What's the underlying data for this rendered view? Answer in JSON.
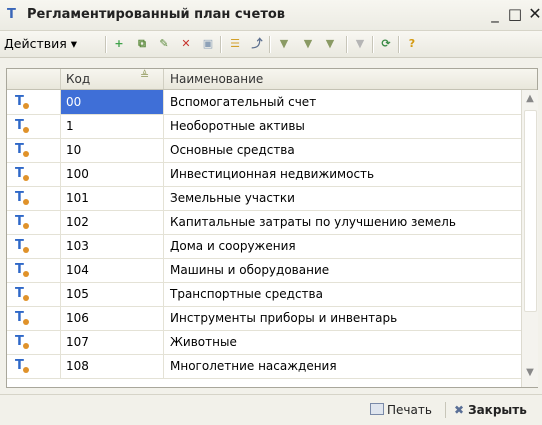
{
  "window": {
    "title": "Регламентированный план счетов",
    "app_icon": "Т",
    "minimize": "_",
    "maximize": "□",
    "close": "✕"
  },
  "toolbar": {
    "actions_label": "Действия",
    "actions_arrow": "▾",
    "icons": [
      {
        "name": "add-icon",
        "glyph": "+",
        "color": "#3fa24a"
      },
      {
        "name": "copy-icon",
        "glyph": "⧉",
        "color": "#5b8a3c"
      },
      {
        "name": "edit-icon",
        "glyph": "✎",
        "color": "#5b8a3c"
      },
      {
        "name": "delete-icon",
        "glyph": "✕",
        "color": "#c7332d"
      },
      {
        "name": "save-icon",
        "glyph": "▣",
        "color": "#8ea2b8"
      },
      {
        "name": "hierarchy-icon",
        "glyph": "☰",
        "color": "#d2a02a"
      },
      {
        "name": "move-icon",
        "glyph": "⤴",
        "color": "#5c6f8f"
      },
      {
        "name": "filter-icon",
        "glyph": "▼",
        "color": "#8a9a64"
      },
      {
        "name": "filter-list-icon",
        "glyph": "▼",
        "color": "#8a9a64"
      },
      {
        "name": "filter-dropdown-icon",
        "glyph": "▼",
        "color": "#8a9a64"
      },
      {
        "name": "clear-filter-icon",
        "glyph": "▼",
        "color": "#b5b5b5"
      },
      {
        "name": "refresh-icon",
        "glyph": "⟳",
        "color": "#3a8a45"
      },
      {
        "name": "help-icon",
        "glyph": "?",
        "color": "#d59a10"
      }
    ]
  },
  "table": {
    "columns": {
      "icon": "",
      "code": "Код",
      "name": "Наименование"
    },
    "sort_icon": "≜",
    "rows": [
      {
        "code": "00",
        "name": "Вспомогательный счет",
        "selected": true
      },
      {
        "code": "1",
        "name": "Необоротные активы"
      },
      {
        "code": "10",
        "name": "Основные средства"
      },
      {
        "code": "100",
        "name": "Инвестиционная недвижимость"
      },
      {
        "code": "101",
        "name": "Земельные участки"
      },
      {
        "code": "102",
        "name": "Капитальные затраты по улучшению земель"
      },
      {
        "code": "103",
        "name": "Дома и сооружения"
      },
      {
        "code": "104",
        "name": "Машины и оборудование"
      },
      {
        "code": "105",
        "name": "Транспортные средства"
      },
      {
        "code": "106",
        "name": "Инструменты приборы и инвентарь"
      },
      {
        "code": "107",
        "name": "Животные"
      },
      {
        "code": "108",
        "name": "Многолетние насаждения"
      }
    ],
    "row_icon": "Т"
  },
  "scrollbar": {
    "up": "▲",
    "down": "▼"
  },
  "bottom": {
    "print_label": "Печать",
    "close_label": "Закрыть",
    "close_glyph": "✖"
  }
}
